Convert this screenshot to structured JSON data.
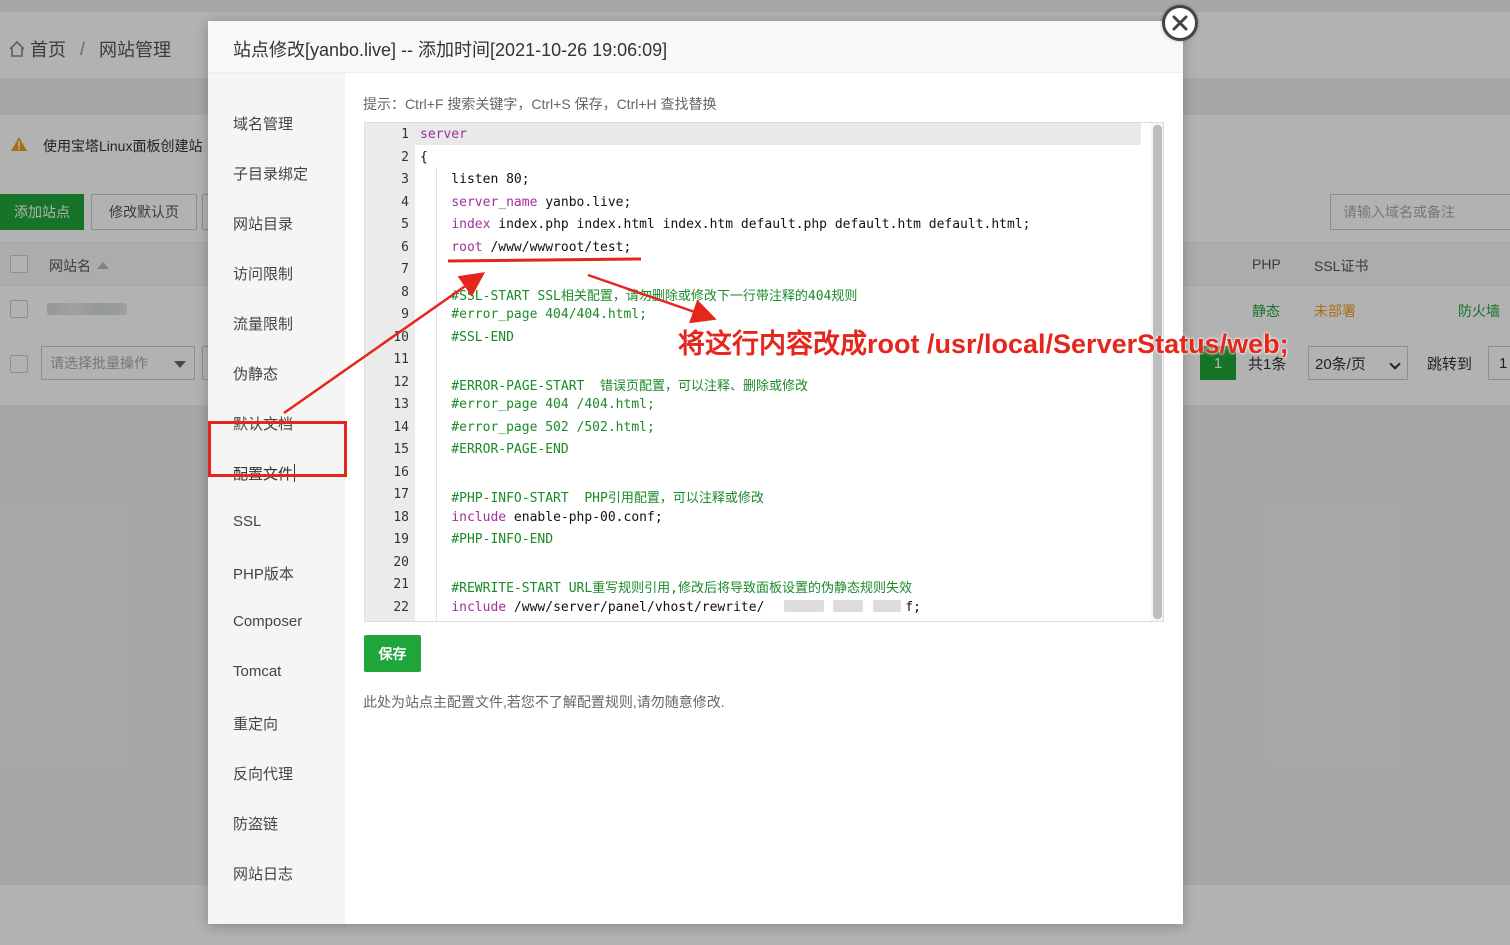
{
  "background": {
    "breadcrumb": {
      "home": "首页",
      "separator": "/",
      "current": "网站管理"
    },
    "notice_text": "使用宝塔Linux面板创建站",
    "toolbar": {
      "add_site": "添加站点",
      "modify_default": "修改默认页"
    },
    "search_placeholder": "请输入域名或备注",
    "table_headers": {
      "site_name": "网站名",
      "php": "PHP",
      "ssl": "SSL证书"
    },
    "row": {
      "php": "静态",
      "ssl": "未部署",
      "firewall": "防火墙"
    },
    "batch_placeholder": "请选择批量操作",
    "pagination": {
      "current": "1",
      "total": "共1条",
      "page_size": "20条/页",
      "jump": "跳转到",
      "jump_value": "1"
    }
  },
  "modal": {
    "title": "站点修改[yanbo.live] -- 添加时间[2021-10-26 19:06:09]",
    "sidebar": [
      "域名管理",
      "子目录绑定",
      "网站目录",
      "访问限制",
      "流量限制",
      "伪静态",
      "默认文档",
      "配置文件",
      "SSL",
      "PHP版本",
      "Composer",
      "Tomcat",
      "重定向",
      "反向代理",
      "防盗链",
      "网站日志"
    ],
    "selected_tab": "配置文件",
    "hint": "提示：Ctrl+F 搜索关键字，Ctrl+S 保存，Ctrl+H 查找替换",
    "code_lines": [
      {
        "n": "1",
        "segments": [
          {
            "t": "server",
            "c": "purple"
          }
        ]
      },
      {
        "n": "2",
        "segments": [
          {
            "t": "{",
            "c": "plain"
          }
        ]
      },
      {
        "n": "3",
        "segments": [
          {
            "t": "    listen 80;",
            "c": "plain"
          }
        ]
      },
      {
        "n": "4",
        "segments": [
          {
            "t": "    ",
            "c": "plain"
          },
          {
            "t": "server_name",
            "c": "purple"
          },
          {
            "t": " yanbo.live;",
            "c": "plain"
          }
        ]
      },
      {
        "n": "5",
        "segments": [
          {
            "t": "    ",
            "c": "plain"
          },
          {
            "t": "index",
            "c": "purple"
          },
          {
            "t": " index.php index.html index.htm default.php default.htm default.html;",
            "c": "plain"
          }
        ]
      },
      {
        "n": "6",
        "segments": [
          {
            "t": "    ",
            "c": "plain"
          },
          {
            "t": "root",
            "c": "purple"
          },
          {
            "t": " /www/wwwroot/test;",
            "c": "plain"
          }
        ]
      },
      {
        "n": "7",
        "segments": []
      },
      {
        "n": "8",
        "segments": [
          {
            "t": "    #SSL-START SSL相关配置，请勿删除或修改下一行带注释的404规则",
            "c": "green"
          }
        ]
      },
      {
        "n": "9",
        "segments": [
          {
            "t": "    #error_page 404/404.html;",
            "c": "green"
          }
        ]
      },
      {
        "n": "10",
        "segments": [
          {
            "t": "    #SSL-END",
            "c": "green"
          }
        ]
      },
      {
        "n": "11",
        "segments": []
      },
      {
        "n": "12",
        "segments": [
          {
            "t": "    #ERROR-PAGE-START  错误页配置，可以注释、删除或修改",
            "c": "green"
          }
        ]
      },
      {
        "n": "13",
        "segments": [
          {
            "t": "    #error_page 404 /404.html;",
            "c": "green"
          }
        ]
      },
      {
        "n": "14",
        "segments": [
          {
            "t": "    #error_page 502 /502.html;",
            "c": "green"
          }
        ]
      },
      {
        "n": "15",
        "segments": [
          {
            "t": "    #ERROR-PAGE-END",
            "c": "green"
          }
        ]
      },
      {
        "n": "16",
        "segments": []
      },
      {
        "n": "17",
        "segments": [
          {
            "t": "    #PHP-INFO-START  PHP引用配置，可以注释或修改",
            "c": "green"
          }
        ]
      },
      {
        "n": "18",
        "segments": [
          {
            "t": "    ",
            "c": "plain"
          },
          {
            "t": "include",
            "c": "purple"
          },
          {
            "t": " enable-php-00.conf;",
            "c": "plain"
          }
        ]
      },
      {
        "n": "19",
        "segments": [
          {
            "t": "    #PHP-INFO-END",
            "c": "green"
          }
        ]
      },
      {
        "n": "20",
        "segments": []
      },
      {
        "n": "21",
        "segments": [
          {
            "t": "    #REWRITE-START URL重写规则引用,修改后将导致面板设置的伪静态规则失效",
            "c": "green"
          }
        ]
      },
      {
        "n": "22",
        "segments": [
          {
            "t": "    ",
            "c": "plain"
          },
          {
            "t": "include",
            "c": "purple"
          },
          {
            "t": " /www/server/panel/vhost/rewrite/",
            "c": "plain"
          },
          {
            "t": "                  ",
            "c": "plain"
          },
          {
            "t": "f;",
            "c": "plain"
          }
        ]
      }
    ],
    "save_label": "保存",
    "footer_note": "此处为站点主配置文件,若您不了解配置规则,请勿随意修改."
  },
  "annotation_text": "将这行内容改成root /usr/local/ServerStatus/web;",
  "colors": {
    "accent_green": "#20a53a",
    "annotation_red": "#e5261c",
    "code_keyword": "#a0309a",
    "code_comment": "#1c8a2a"
  }
}
